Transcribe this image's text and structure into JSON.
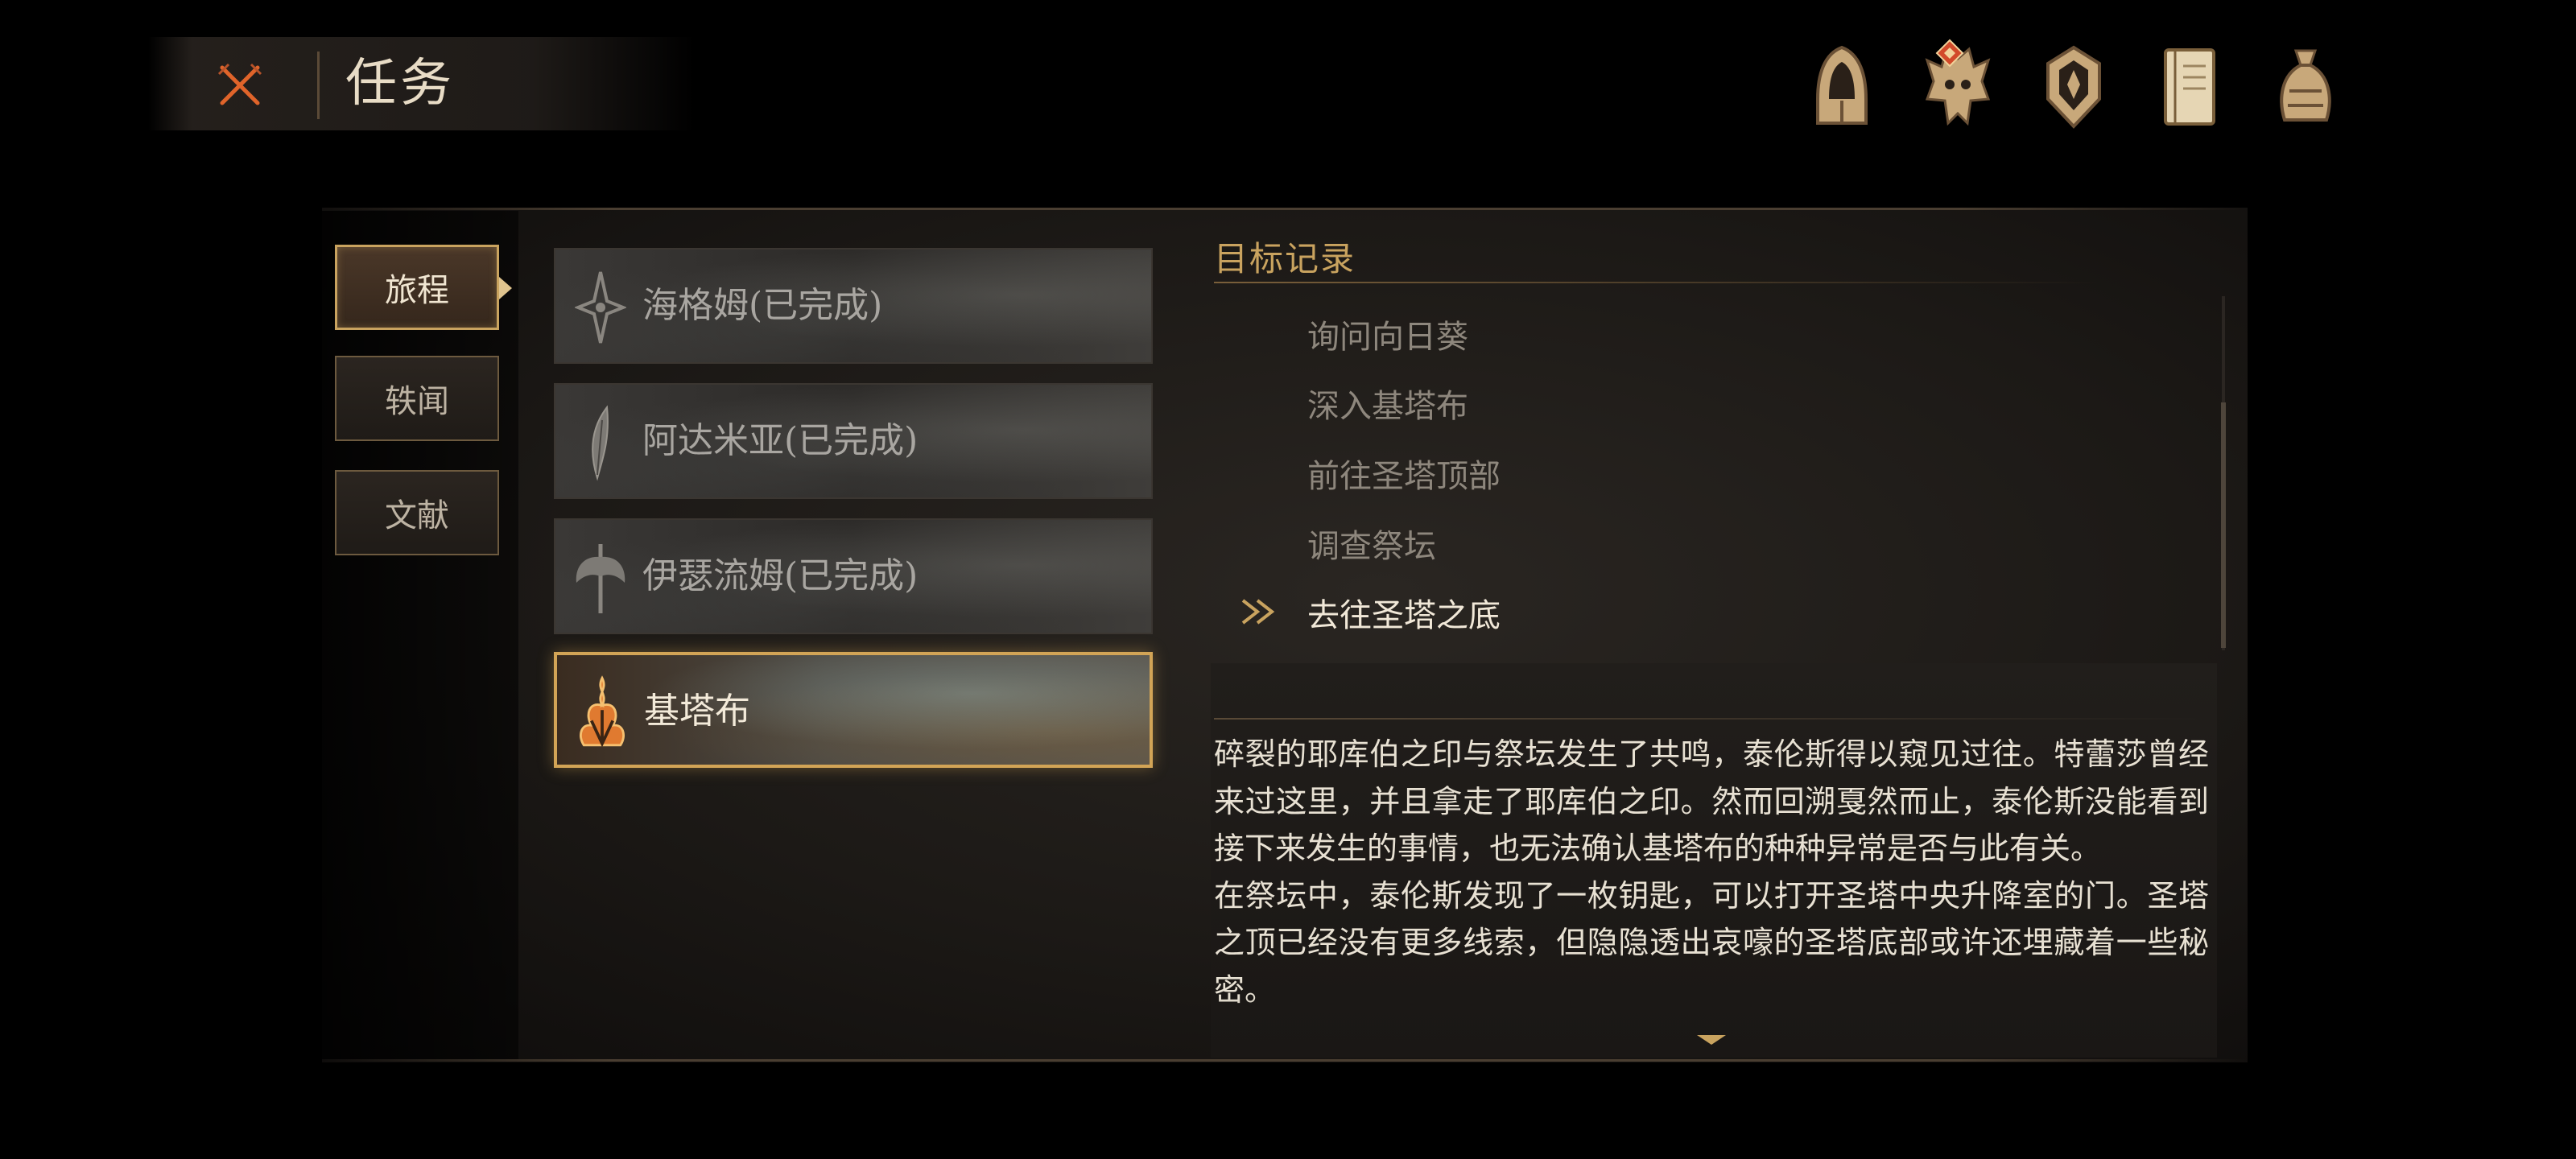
{
  "header": {
    "title": "任务",
    "close_icon": "crossed-swords-close-icon",
    "accent_color": "#e0642a"
  },
  "top_icons": [
    {
      "name": "hooded-figure-icon"
    },
    {
      "name": "beast-skull-icon",
      "badge": "notification-diamond-icon"
    },
    {
      "name": "shield-emblem-icon"
    },
    {
      "name": "journal-book-icon"
    },
    {
      "name": "coin-pouch-icon"
    }
  ],
  "side_tabs": [
    {
      "label": "旅程",
      "active": true
    },
    {
      "label": "轶闻",
      "active": false
    },
    {
      "label": "文献",
      "active": false
    }
  ],
  "quests": [
    {
      "label": "海格姆(已完成)",
      "icon": "compass-star-icon",
      "active": false
    },
    {
      "label": "阿达米亚(已完成)",
      "icon": "feather-blade-icon",
      "active": false
    },
    {
      "label": "伊瑟流姆(已完成)",
      "icon": "winged-axe-icon",
      "active": false
    },
    {
      "label": "基塔布",
      "icon": "flame-crest-icon",
      "active": true
    }
  ],
  "objectives": {
    "title": "目标记录",
    "items": [
      {
        "label": "询问向日葵",
        "current": false
      },
      {
        "label": "深入基塔布",
        "current": false
      },
      {
        "label": "前往圣塔顶部",
        "current": false
      },
      {
        "label": "调查祭坛",
        "current": false
      },
      {
        "label": "去往圣塔之底",
        "current": true
      }
    ]
  },
  "description": {
    "paragraphs": [
      "碎裂的耶库伯之印与祭坛发生了共鸣，泰伦斯得以窥见过往。特蕾莎曾经来过这里，并且拿走了耶库伯之印。然而回溯戛然而止，泰伦斯没能看到接下来发生的事情，也无法确认基塔布的种种异常是否与此有关。",
      "在祭坛中，泰伦斯发现了一枚钥匙，可以打开圣塔中央升降室的门。圣塔之顶已经没有更多线索，但隐隐透出哀嚎的圣塔底部或许还埋藏着一些秘密。"
    ]
  },
  "colors": {
    "gold": "#c9a35f",
    "active_border": "#d2a456",
    "text_primary": "#e8e1d3",
    "text_muted": "#8e877d"
  }
}
